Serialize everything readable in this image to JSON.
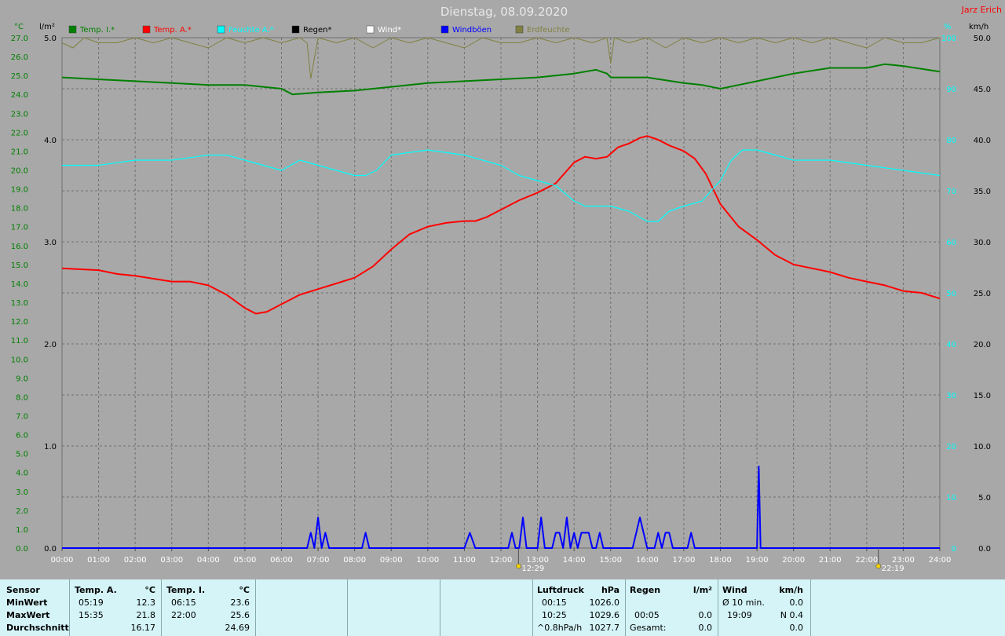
{
  "chart_data": {
    "type": "line",
    "title": "Dienstag, 08.09.2020",
    "author": "Jarz Erich",
    "left_axis_units": {
      "temp": "°C",
      "rain": "l/m²"
    },
    "right_axis_units": {
      "humidity": "%",
      "wind": "km/h"
    },
    "x_ticks": [
      "00:00",
      "01:00",
      "02:00",
      "03:00",
      "04:00",
      "05:00",
      "06:00",
      "07:00",
      "08:00",
      "09:00",
      "10:00",
      "11:00",
      "12:00",
      "13:00",
      "14:00",
      "15:00",
      "16:00",
      "17:00",
      "18:00",
      "19:00",
      "20:00",
      "21:00",
      "22:00",
      "23:00",
      "24:00"
    ],
    "temp_ticks": [
      "27.0",
      "26.0",
      "25.0",
      "24.0",
      "23.0",
      "22.0",
      "21.0",
      "20.0",
      "19.0",
      "18.0",
      "17.0",
      "16.0",
      "15.0",
      "14.0",
      "13.0",
      "12.0",
      "11.0",
      "10.0",
      "9.0",
      "8.0",
      "7.0",
      "6.0",
      "5.0",
      "4.0",
      "3.0",
      "2.0",
      "1.0",
      "0.0"
    ],
    "rain_ticks": [
      "5.0",
      "4.0",
      "3.0",
      "2.0",
      "1.0",
      "0.0"
    ],
    "hum_ticks": [
      "100",
      "90",
      "80",
      "70",
      "60",
      "50",
      "40",
      "30",
      "20",
      "10",
      "0"
    ],
    "wind_ticks": [
      "50.0",
      "45.0",
      "40.0",
      "35.0",
      "30.0",
      "25.0",
      "20.0",
      "15.0",
      "10.0",
      "5.0",
      "0.0"
    ],
    "ranges": {
      "x": [
        0,
        24
      ],
      "temp": [
        0,
        27
      ],
      "rain": [
        0,
        5
      ],
      "humidity": [
        0,
        100
      ],
      "wind": [
        0,
        50
      ]
    },
    "grid": true,
    "legend": [
      {
        "label": "Temp. I.*",
        "color": "#008000"
      },
      {
        "label": "Temp. A.*",
        "color": "#ff0000"
      },
      {
        "label": "Feuchte A.*",
        "color": "#00ffff"
      },
      {
        "label": "Regen*",
        "color": "#000000"
      },
      {
        "label": "Wind*",
        "color": "#ffffff"
      },
      {
        "label": "Windböen",
        "color": "#0000ff"
      },
      {
        "label": "Erdfeuchte",
        "color": "#808040"
      }
    ],
    "series": [
      {
        "name": "Temp. I.*",
        "color": "#008000",
        "axis": "temp",
        "x": [
          0,
          1,
          2,
          3,
          4,
          5,
          6,
          6.3,
          7,
          8,
          9,
          10,
          11,
          12,
          13,
          14,
          14.6,
          14.9,
          15,
          15.5,
          16,
          17,
          17.5,
          18,
          18.5,
          19,
          20,
          21,
          22,
          22.5,
          23,
          24
        ],
        "y": [
          24.9,
          24.8,
          24.7,
          24.6,
          24.5,
          24.5,
          24.3,
          24.0,
          24.1,
          24.2,
          24.4,
          24.6,
          24.7,
          24.8,
          24.9,
          25.1,
          25.3,
          25.1,
          24.9,
          24.9,
          24.9,
          24.6,
          24.5,
          24.3,
          24.5,
          24.7,
          25.1,
          25.4,
          25.4,
          25.6,
          25.5,
          25.2
        ]
      },
      {
        "name": "Temp. A.*",
        "color": "#ff0000",
        "axis": "temp",
        "x": [
          0,
          1,
          1.5,
          2,
          3,
          3.5,
          4,
          4.5,
          5,
          5.3,
          5.6,
          6,
          6.5,
          7,
          7.5,
          8,
          8.5,
          9,
          9.5,
          10,
          10.5,
          11,
          11.3,
          11.6,
          12,
          12.5,
          13,
          13.5,
          14,
          14.3,
          14.6,
          14.9,
          15.2,
          15.5,
          15.8,
          16,
          16.3,
          16.6,
          17,
          17.3,
          17.6,
          18,
          18.5,
          19,
          19.5,
          20,
          20.5,
          21,
          21.5,
          22,
          22.5,
          23,
          23.5,
          24
        ],
        "y": [
          14.8,
          14.7,
          14.5,
          14.4,
          14.1,
          14.1,
          13.9,
          13.4,
          12.7,
          12.4,
          12.5,
          12.9,
          13.4,
          13.7,
          14.0,
          14.3,
          14.9,
          15.8,
          16.6,
          17.0,
          17.2,
          17.3,
          17.3,
          17.5,
          17.9,
          18.4,
          18.8,
          19.3,
          20.4,
          20.7,
          20.6,
          20.7,
          21.2,
          21.4,
          21.7,
          21.8,
          21.6,
          21.3,
          21.0,
          20.6,
          19.8,
          18.2,
          17.0,
          16.3,
          15.5,
          15.0,
          14.8,
          14.6,
          14.3,
          14.1,
          13.9,
          13.6,
          13.5,
          13.2
        ]
      },
      {
        "name": "Feuchte A.*",
        "color": "#00ffff",
        "axis": "humidity",
        "x": [
          0,
          1,
          2,
          3,
          4,
          4.5,
          5,
          5.5,
          6,
          6.5,
          7,
          8,
          8.3,
          8.6,
          9,
          10,
          11,
          11.5,
          12,
          12.5,
          13,
          13.5,
          14,
          14.3,
          14.6,
          15,
          15.5,
          16,
          16.3,
          16.6,
          17,
          17.5,
          18,
          18.3,
          18.6,
          19,
          19.5,
          20,
          21,
          22,
          23,
          24
        ],
        "y": [
          75,
          75,
          76,
          76,
          77,
          77,
          76,
          75,
          74,
          76,
          75,
          73,
          73,
          74,
          77,
          78,
          77,
          76,
          75,
          73,
          72,
          71,
          68,
          67,
          67,
          67,
          66,
          64,
          64,
          66,
          67,
          68,
          72,
          76,
          78,
          78,
          77,
          76,
          76,
          75,
          74,
          73
        ]
      },
      {
        "name": "Windböen",
        "color": "#0000ff",
        "axis": "wind",
        "x": [
          0,
          6.7,
          6.8,
          6.9,
          7.0,
          7.1,
          7.2,
          7.3,
          8.2,
          8.3,
          8.4,
          11.0,
          11.15,
          11.3,
          12.2,
          12.3,
          12.4,
          12.5,
          12.6,
          12.7,
          12.8,
          13.0,
          13.1,
          13.2,
          13.4,
          13.5,
          13.6,
          13.7,
          13.8,
          13.9,
          14.0,
          14.1,
          14.2,
          14.4,
          14.5,
          14.6,
          14.7,
          14.8,
          15.0,
          15.6,
          15.8,
          16.0,
          16.2,
          16.3,
          16.4,
          16.5,
          16.6,
          16.7,
          16.9,
          17.1,
          17.2,
          17.3,
          19.0,
          19.05,
          19.1,
          19.15,
          19.2,
          24
        ],
        "y": [
          0,
          0,
          1.5,
          0,
          3.0,
          0,
          1.5,
          0,
          0,
          1.5,
          0,
          0,
          1.5,
          0,
          0,
          1.5,
          0,
          0,
          3.0,
          0,
          0,
          0,
          3.0,
          0,
          0,
          1.5,
          1.5,
          0,
          3.0,
          0,
          1.5,
          0,
          1.5,
          1.5,
          0,
          0,
          1.5,
          0,
          0,
          0,
          3.0,
          0,
          0,
          1.5,
          0,
          1.5,
          1.5,
          0,
          0,
          0,
          1.5,
          0,
          0,
          8.0,
          0,
          0,
          0,
          0
        ]
      },
      {
        "name": "Erdfeuchte",
        "color": "#808040",
        "axis": "humidity",
        "x": [
          0,
          0.3,
          0.6,
          1,
          1.5,
          2,
          2.5,
          3,
          3.5,
          4,
          4.5,
          5,
          5.5,
          6,
          6.5,
          6.7,
          6.8,
          7,
          7.5,
          8,
          8.5,
          9,
          9.5,
          10,
          10.5,
          11,
          11.5,
          12,
          12.5,
          13,
          13.5,
          14,
          14.5,
          14.9,
          15.0,
          15.1,
          15.5,
          16,
          16.5,
          17,
          17.5,
          18,
          18.5,
          19,
          19.5,
          20,
          20.5,
          21,
          21.5,
          22,
          22.5,
          23,
          23.5,
          24
        ],
        "y": [
          99,
          98,
          100,
          99,
          99,
          100,
          99,
          100,
          99,
          98,
          100,
          99,
          100,
          99,
          100,
          99,
          92,
          100,
          99,
          100,
          98,
          100,
          99,
          100,
          99,
          98,
          100,
          99,
          99,
          100,
          99,
          100,
          99,
          100,
          95,
          100,
          99,
          100,
          98,
          100,
          99,
          100,
          99,
          100,
          99,
          100,
          99,
          100,
          99,
          98,
          100,
          99,
          99,
          100
        ]
      }
    ],
    "annotations": [
      {
        "label": "12:29",
        "x": 12.48
      },
      {
        "label": "22:19",
        "x": 22.32
      }
    ]
  },
  "stats": {
    "sensor_label": "Sensor",
    "row_labels": [
      "MinWert",
      "MaxWert",
      "Durchschnitt"
    ],
    "temp_a": {
      "header": "Temp. A.",
      "unit": "°C",
      "min_time": "05:19",
      "min_val": "12.3",
      "max_time": "15:35",
      "max_val": "21.8",
      "avg": "16.17"
    },
    "temp_i": {
      "header": "Temp. I.",
      "unit": "°C",
      "min_time": "06:15",
      "min_val": "23.6",
      "max_time": "22:00",
      "max_val": "25.6",
      "avg": "24.69"
    },
    "pressure": {
      "header": "Luftdruck",
      "unit": "hPa",
      "min_time": "00:15",
      "min_val": "1026.0",
      "max_time": "10:25",
      "max_val": "1029.6",
      "trend": "^0.8hPa/h",
      "avg": "1027.7"
    },
    "rain": {
      "header": "Regen",
      "unit": "l/m²",
      "max_time": "00:05",
      "max_val": "0.0",
      "total_label": "Gesamt:",
      "total": "0.0"
    },
    "wind": {
      "header": "Wind",
      "unit": "km/h",
      "avg_label": "Ø 10 min.",
      "avg_val": "0.0",
      "max_time": "19:09",
      "max_val": "N 0.4",
      "last_val": "0.0"
    }
  }
}
